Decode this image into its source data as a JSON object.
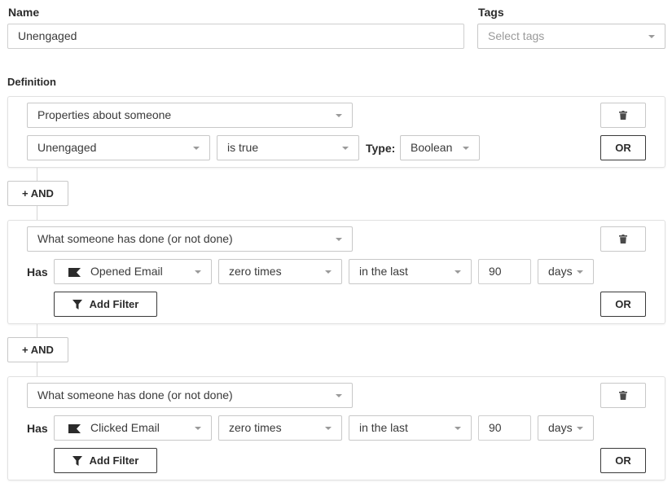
{
  "name_field": {
    "label": "Name",
    "value": "Unengaged"
  },
  "tags_field": {
    "label": "Tags",
    "placeholder": "Select tags"
  },
  "definition": {
    "label": "Definition",
    "conditions": [
      {
        "category": "Properties about someone",
        "property": "Unengaged",
        "operator": "is true",
        "type_label": "Type:",
        "type_value": "Boolean",
        "or_label": "OR"
      },
      {
        "category": "What someone has done (or not done)",
        "has_label": "Has",
        "metric": "Opened Email",
        "frequency": "zero times",
        "timeframe": "in the last",
        "amount": "90",
        "unit": "days",
        "add_filter_label": "Add Filter",
        "or_label": "OR"
      },
      {
        "category": "What someone has done (or not done)",
        "has_label": "Has",
        "metric": "Clicked Email",
        "frequency": "zero times",
        "timeframe": "in the last",
        "amount": "90",
        "unit": "days",
        "add_filter_label": "Add Filter",
        "or_label": "OR"
      }
    ],
    "and_buttons": [
      "+ AND",
      "+ AND"
    ]
  }
}
